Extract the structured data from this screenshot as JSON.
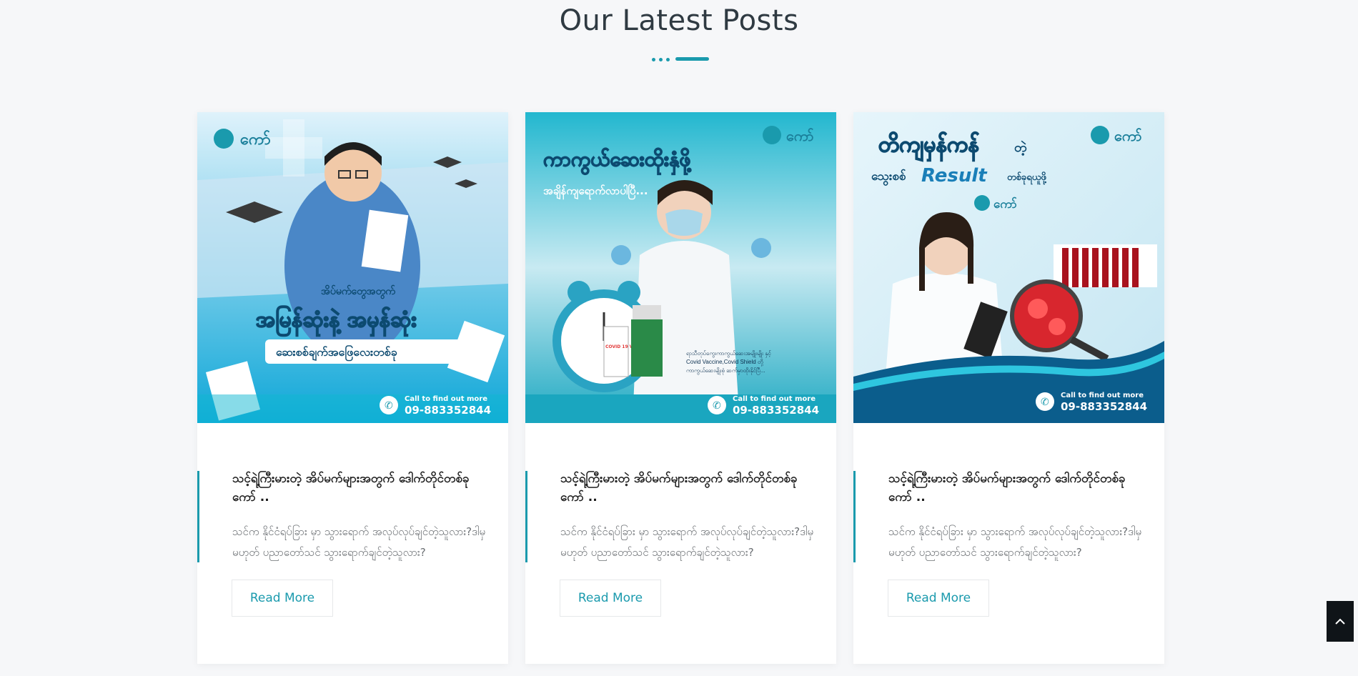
{
  "section": {
    "title": "Our Latest Posts"
  },
  "theme": {
    "accent": "#1a9aad",
    "dark": "#0f1418"
  },
  "posts": [
    {
      "title": "သင့်ရဲ့ကြီးမားတဲ့ အိပ်မက်များအတွက် ဒေါက်တိုင်တစ်ခု ကော် ..",
      "excerpt": "သင်က နိုင်ငံရပ်ခြား မှာ သွားရောက် အလုပ်လုပ်ချင်တဲ့သူလား?ဒါမှမဟုတ် ပညာတော်သင် သွားရောက်ချင်တဲ့သူလား?",
      "read_more": "Read More",
      "image": {
        "brand": "ကော်",
        "headline_small": "အိပ်မက်တွေအတွက်",
        "headline": "အမြန်ဆုံးနဲ့ အမှန်ဆုံး",
        "subline": "ဆေးစစ်ချက်အဖြေလေးတစ်ခု",
        "call_text": "Call to find out more",
        "phone": "09-883352844"
      }
    },
    {
      "title": "သင့်ရဲ့ကြီးမားတဲ့ အိပ်မက်များအတွက် ဒေါက်တိုင်တစ်ခု ကော် ..",
      "excerpt": "သင်က နိုင်ငံရပ်ခြား မှာ သွားရောက် အလုပ်လုပ်ချင်တဲ့သူလား?ဒါမှမဟုတ် ပညာတော်သင် သွားရောက်ချင်တဲ့သူလား?",
      "read_more": "Read More",
      "image": {
        "brand": "ကော်",
        "headline": "ကာကွယ်ဆေးထိုးနှံဖို့",
        "subline": "အချိန်ကျရောက်လာပါပြီ...",
        "note_line1": "ရာသီတုပ်ကွေးကာကွယ်ဆေးအမျိုးမျိုး နှင့်",
        "note_line2": "Covid Vaccine,Covid Shield တို့",
        "note_line3": "ကာကွယ်ဆေးမျိုးစုံ ဆက်မှာထိုးနိုင်ပြီ...",
        "vial1": "COVID 19 VACCINE",
        "call_text": "Call to find out more",
        "phone": "09-883352844"
      }
    },
    {
      "title": "သင့်ရဲ့ကြီးမားတဲ့ အိပ်မက်များအတွက် ဒေါက်တိုင်တစ်ခု ကော် ..",
      "excerpt": "သင်က နိုင်ငံရပ်ခြား မှာ သွားရောက် အလုပ်လုပ်ချင်တဲ့သူလား?ဒါမှမဟုတ် ပညာတော်သင် သွားရောက်ချင်တဲ့သူလား?",
      "read_more": "Read More",
      "image": {
        "brand": "ကော်",
        "headline": "တိကျမှန်ကန်",
        "headline_suffix": "တဲ့",
        "sub_prefix": "သွေးစစ်",
        "sub_result": "Result",
        "sub_suffix": "တစ်ခုရယူဖို့",
        "brand2": "ကော်",
        "call_text": "Call to find out more",
        "phone": "09-883352844"
      }
    }
  ]
}
